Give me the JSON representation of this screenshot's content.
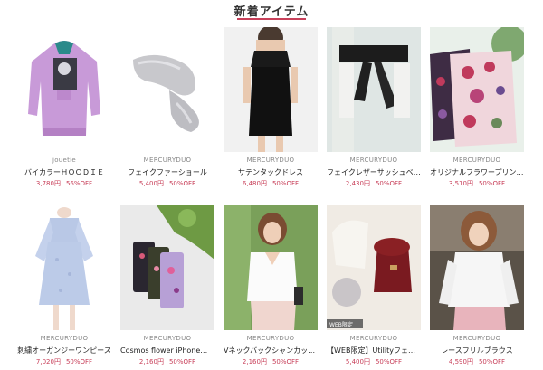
{
  "section": {
    "title": "新着アイテム"
  },
  "accent": "#c8405a",
  "rows": [
    [
      {
        "brand": "jouetie",
        "name": "バイカラーＨＯＯＤＩＥ",
        "price": "3,780円",
        "discount": "56%OFF",
        "icon": "hoodie-product-image"
      },
      {
        "brand": "MERCURYDUO",
        "name": "フェイクファーショール",
        "price": "5,400円",
        "discount": "50%OFF",
        "icon": "fur-shawl-product-image"
      },
      {
        "brand": "MERCURYDUO",
        "name": "サテンタックドレス",
        "price": "6,480円",
        "discount": "50%OFF",
        "icon": "black-dress-product-image"
      },
      {
        "brand": "MERCURYDUO",
        "name": "フェイクレザーサッシュベルト",
        "price": "2,430円",
        "discount": "50%OFF",
        "icon": "sash-belt-product-image"
      },
      {
        "brand": "MERCURYDUO",
        "name": "オリジナルフラワープリント…",
        "price": "3,510円",
        "discount": "50%OFF",
        "icon": "flower-case-product-image"
      }
    ],
    [
      {
        "brand": "MERCURYDUO",
        "name": "刺繍オーガンジーワンピース",
        "price": "7,020円",
        "discount": "50%OFF",
        "icon": "lace-dress-product-image"
      },
      {
        "brand": "MERCURYDUO",
        "name": "Cosmos flower iPhoneケ…",
        "price": "2,160円",
        "discount": "50%OFF",
        "icon": "iphone-case-product-image"
      },
      {
        "brand": "MERCURYDUO",
        "name": "Vネックバックシャンカット…",
        "price": "2,160円",
        "discount": "50%OFF",
        "icon": "vneck-top-product-image"
      },
      {
        "brand": "MERCURYDUO",
        "name": "【WEB限定】Utilityフェイ…",
        "price": "5,400円",
        "discount": "50%OFF",
        "icon": "fur-bag-product-image",
        "tag": "WEB限定"
      },
      {
        "brand": "MERCURYDUO",
        "name": "レースフリルブラウス",
        "price": "4,590円",
        "discount": "50%OFF",
        "icon": "lace-blouse-product-image"
      }
    ]
  ]
}
